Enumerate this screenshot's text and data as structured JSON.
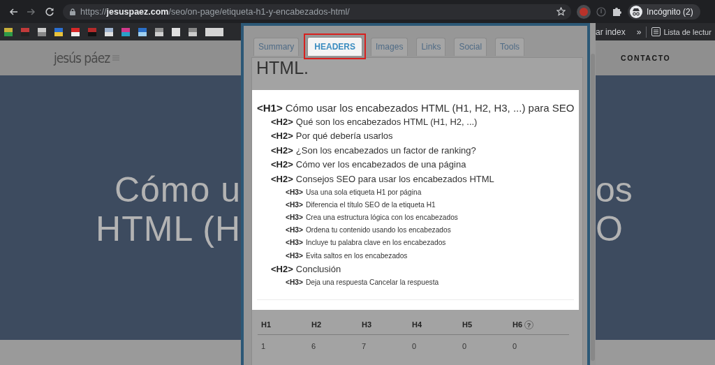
{
  "browser": {
    "nav_buttons": [
      {
        "kind": "back",
        "disabled": false
      },
      {
        "kind": "forward",
        "disabled": true
      },
      {
        "kind": "reload",
        "disabled": false
      }
    ],
    "address": {
      "scheme": "https://",
      "domain": "jesuspaez.com",
      "path": "/seo/on-page/etiqueta-h1-y-encabezados-html/"
    },
    "profile": "Incógnito (2)"
  },
  "bookmarks_bar": {
    "bookmarks": [
      {
        "label": "ar index"
      }
    ],
    "more": "»",
    "reading_list": "Lista de lectur"
  },
  "page": {
    "logo": "jesús páez",
    "nav": [
      "CONTACTO"
    ],
    "hero_title_lines": [
      {
        "left": "Cómo u",
        "right": "os"
      },
      {
        "left": "HTML (H",
        "right": "O"
      }
    ]
  },
  "extension_popup": {
    "tabs": [
      {
        "label": "Summary",
        "selected": false,
        "highlighted": false
      },
      {
        "label": "HEADERS",
        "selected": true,
        "highlighted": true
      },
      {
        "label": "Images",
        "selected": false,
        "highlighted": false
      },
      {
        "label": "Links",
        "selected": false,
        "highlighted": false
      },
      {
        "label": "Social",
        "selected": false,
        "highlighted": false
      },
      {
        "label": "Tools",
        "selected": false,
        "highlighted": false
      }
    ],
    "heading_fragment": "HTML.",
    "headings": [
      {
        "tag": "<H1>",
        "text": "Cómo usar los encabezados HTML (H1, H2, H3, ...) para SEO",
        "children": [
          {
            "tag": "<H2>",
            "text": "Qué son los encabezados HTML (H1, H2, ...)"
          },
          {
            "tag": "<H2>",
            "text": "Por qué debería usarlos"
          },
          {
            "tag": "<H2>",
            "text": "¿Son los encabezados un factor de ranking?"
          },
          {
            "tag": "<H2>",
            "text": "Cómo ver los encabezados de una página"
          },
          {
            "tag": "<H2>",
            "text": "Consejos SEO para usar los encabezados HTML",
            "children": [
              {
                "tag": "<H3>",
                "text": "Usa una sola etiqueta H1 por página"
              },
              {
                "tag": "<H3>",
                "text": "Diferencia el título SEO de la etiqueta H1"
              },
              {
                "tag": "<H3>",
                "text": "Crea una estructura lógica con los encabezados"
              },
              {
                "tag": "<H3>",
                "text": "Ordena tu contenido usando los encabezados"
              },
              {
                "tag": "<H3>",
                "text": "Incluye tu palabra clave en los encabezados"
              },
              {
                "tag": "<H3>",
                "text": "Evita saltos en los encabezados"
              }
            ]
          },
          {
            "tag": "<H2>",
            "text": "Conclusión",
            "children": [
              {
                "tag": "<H3>",
                "text": "Deja una respuesta Cancelar la respuesta"
              }
            ]
          }
        ]
      }
    ],
    "counts": {
      "columns": [
        {
          "label": "H1"
        },
        {
          "label": "H2"
        },
        {
          "label": "H3"
        },
        {
          "label": "H4"
        },
        {
          "label": "H5"
        },
        {
          "label": "H6",
          "help": "?"
        }
      ],
      "values": [
        "1",
        "6",
        "7",
        "0",
        "0",
        "0"
      ]
    }
  }
}
